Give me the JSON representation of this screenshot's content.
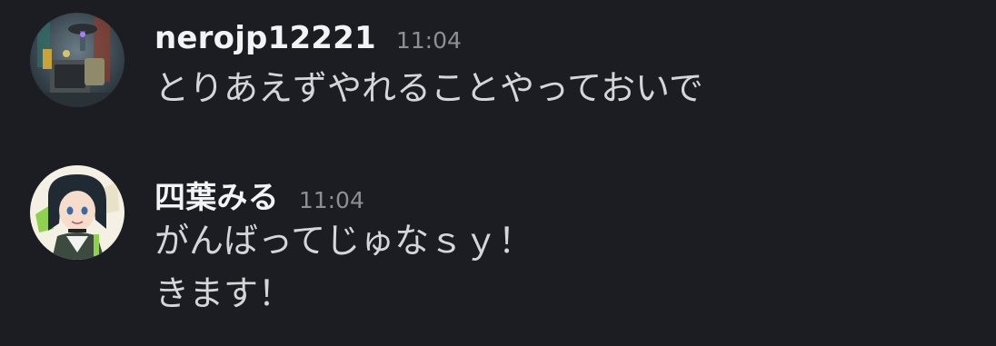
{
  "messages": [
    {
      "username": "nerojp12221",
      "timestamp": "11:04",
      "avatar": "robot-avatar-icon",
      "lines": [
        "とりあえずやれることやっておいで"
      ]
    },
    {
      "username": "四葉みる",
      "timestamp": "11:04",
      "avatar": "anime-girl-avatar-icon",
      "lines": [
        "がんばってじゅなｓｙ！",
        "きます！"
      ]
    }
  ],
  "colors": {
    "background": "#1c1d22",
    "username": "#f2f3f5",
    "timestamp": "#8d8f97",
    "message_text": "#d4d6da"
  }
}
